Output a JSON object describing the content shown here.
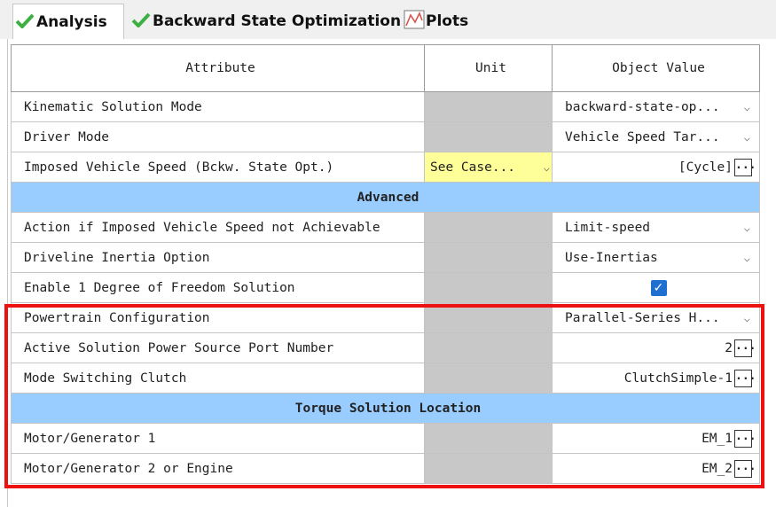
{
  "tabs": [
    {
      "label": "Analysis",
      "icon": "checkmark-icon"
    },
    {
      "label": "Backward State Optimization",
      "icon": "checkmark-icon"
    },
    {
      "label": "Plots",
      "icon": "plot-icon"
    }
  ],
  "columns": {
    "attribute": "Attribute",
    "unit": "Unit",
    "value": "Object Value"
  },
  "rows": {
    "kinematic": {
      "attribute": "Kinematic Solution Mode",
      "value": "backward-state-op..."
    },
    "driver": {
      "attribute": "Driver Mode",
      "value": "Vehicle Speed Tar..."
    },
    "imposed": {
      "attribute": "Imposed Vehicle Speed (Bckw. State Opt.)",
      "unit": "See Case...",
      "value": "[Cycle]"
    },
    "section_advanced": "Advanced",
    "action": {
      "attribute": "Action if Imposed Vehicle Speed not Achievable",
      "value": "Limit-speed"
    },
    "inertia": {
      "attribute": "Driveline Inertia Option",
      "value": "Use-Inertias"
    },
    "dof": {
      "attribute": "Enable 1 Degree of Freedom Solution",
      "checked": true
    },
    "powertrain": {
      "attribute": "Powertrain Configuration",
      "value": "Parallel-Series H..."
    },
    "port": {
      "attribute": "Active Solution Power Source Port Number",
      "value": "2"
    },
    "clutch": {
      "attribute": "Mode Switching Clutch",
      "value": "ClutchSimple-1"
    },
    "section_torque": "Torque Solution Location",
    "mg1": {
      "attribute": "Motor/Generator 1",
      "value": "EM_1"
    },
    "mg2": {
      "attribute": "Motor/Generator 2 or Engine",
      "value": "EM_2"
    }
  },
  "glyphs": {
    "dots": "...",
    "chevron": "⌵",
    "check": "✓"
  },
  "colors": {
    "section": "#99ccff",
    "highlight": "#ffff99",
    "unit_disabled": "#c8c8c8",
    "checkbox": "#1f6fd1",
    "red_outline": "#ee1111",
    "check_green": "#3cb043"
  }
}
